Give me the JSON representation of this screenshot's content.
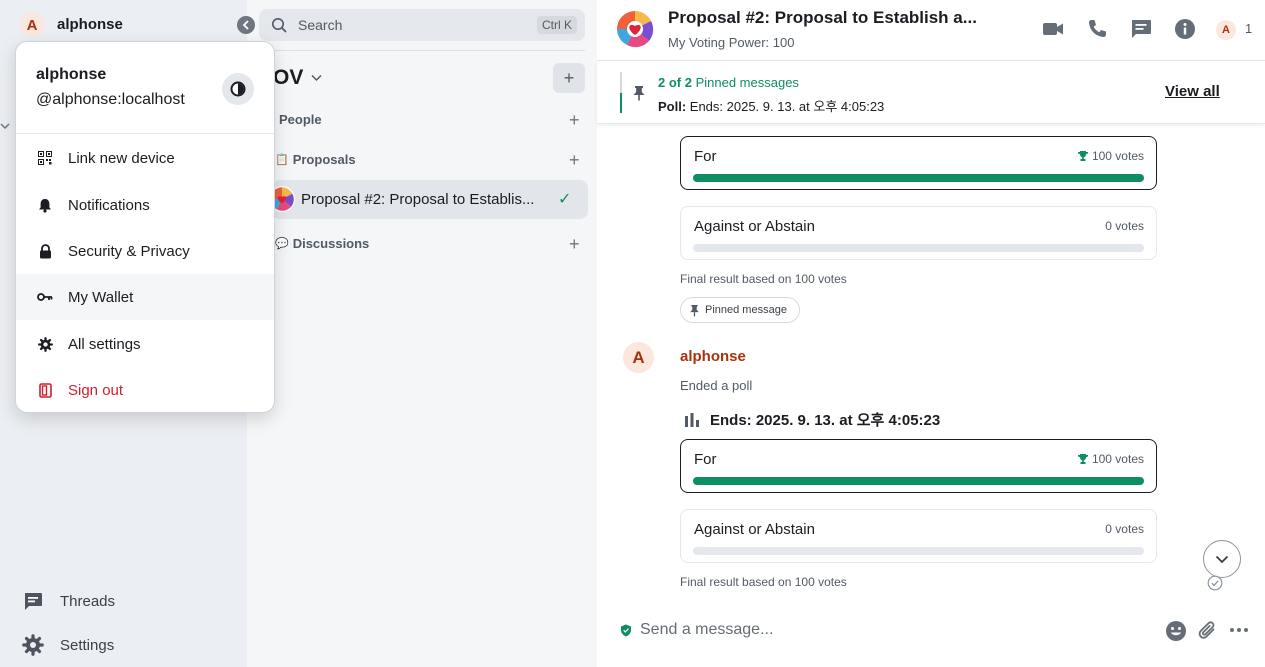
{
  "colors": {
    "accent": "#0d8e63",
    "danger": "#d0202d",
    "sender": "#a8320e"
  },
  "sidebar": {
    "user_initial": "A",
    "user_name": "alphonse",
    "bottom": [
      {
        "label": "Threads",
        "icon": "threads-icon"
      },
      {
        "label": "Settings",
        "icon": "gear-icon"
      }
    ]
  },
  "user_menu": {
    "display_name": "alphonse",
    "user_id": "@alphonse:localhost",
    "items": [
      {
        "label": "Link new device",
        "icon": "qr-code-icon"
      },
      {
        "label": "Notifications",
        "icon": "bell-icon"
      },
      {
        "label": "Security & Privacy",
        "icon": "lock-icon"
      },
      {
        "label": "My Wallet",
        "icon": "key-icon"
      },
      {
        "label": "All settings",
        "icon": "gear-icon"
      },
      {
        "label": "Sign out",
        "icon": "sign-out-icon"
      }
    ]
  },
  "room_list": {
    "search_placeholder": "Search",
    "search_shortcut": "Ctrl K",
    "space_name": "OV",
    "sections": [
      {
        "label": "People",
        "emoji": ""
      },
      {
        "label": "Proposals",
        "emoji": "📋"
      },
      {
        "label": "Discussions",
        "emoji": "💬"
      }
    ],
    "active_room": "Proposal #2: Proposal to Establis...",
    "active_room_check": "✓"
  },
  "room_header": {
    "title": "Proposal #2: Proposal to Establish a...",
    "topic": "My Voting Power: 100",
    "member_initial": "A",
    "member_count": "1"
  },
  "pinned": {
    "count_prefix": "2 of 2",
    "count_suffix": " Pinned messages",
    "content_label": "Poll:",
    "content_text": " Ends: 2025. 9. 13. at 오후 4:05:23",
    "view_all": "View all"
  },
  "timeline": {
    "poll1": {
      "options": [
        {
          "label": "For",
          "votes": "100 votes",
          "fraction": 1.0,
          "winner": true
        },
        {
          "label": "Against or Abstain",
          "votes": "0 votes",
          "fraction": 0.0,
          "winner": false
        }
      ],
      "final": "Final result based on 100 votes",
      "pinned_chip": "Pinned message"
    },
    "message": {
      "sender_initial": "A",
      "sender": "alphonse",
      "summary": "Ended a poll"
    },
    "poll2": {
      "question": "Ends: 2025. 9. 13. at 오후 4:05:23",
      "options": [
        {
          "label": "For",
          "votes": "100 votes",
          "fraction": 1.0,
          "winner": true
        },
        {
          "label": "Against or Abstain",
          "votes": "0 votes",
          "fraction": 0.0,
          "winner": false
        }
      ],
      "final": "Final result based on 100 votes"
    }
  },
  "composer": {
    "placeholder": "Send a message..."
  }
}
